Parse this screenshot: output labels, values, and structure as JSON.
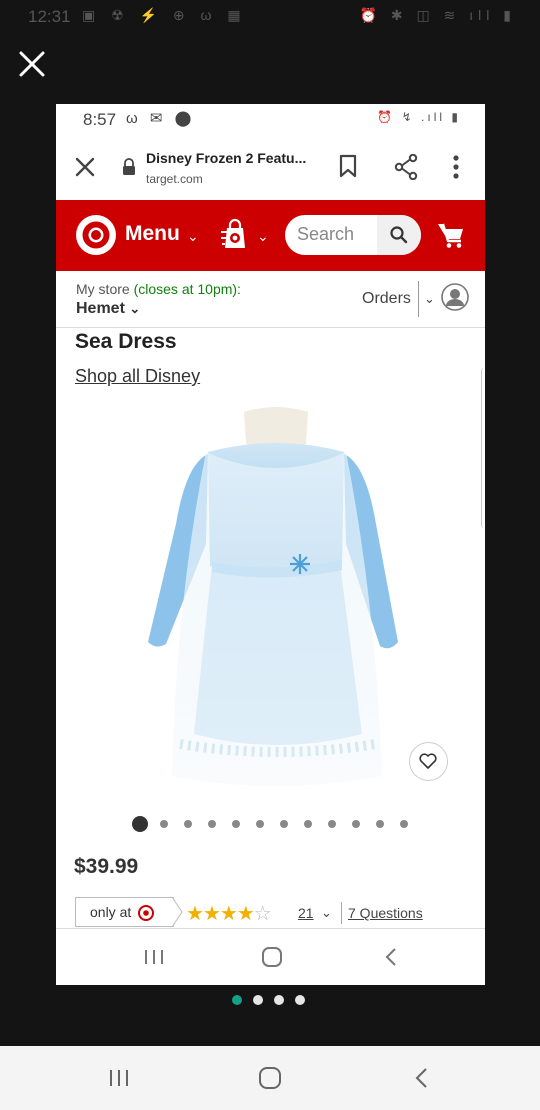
{
  "outer_status": {
    "time": "12:31",
    "left_icons": "▣ ☢ ⚡ ⊕ ω ▦",
    "right_icons": "⏰ ✱ ◫ ≋ ıll ▮"
  },
  "inner_status": {
    "time": "8:57",
    "left_icons": "ω ✉ ⬤",
    "right_icons": "⏰ ↯ .ıll ▮"
  },
  "browser": {
    "page_title": "Disney Frozen 2 Featu...",
    "domain": "target.com"
  },
  "header": {
    "menu_label": "Menu",
    "search_placeholder": "Search",
    "brand_color": "#cc0000"
  },
  "store": {
    "label": "My store",
    "hours": "(closes at 10pm):",
    "name": "Hemet",
    "orders_label": "Orders"
  },
  "product": {
    "title": "Sea Dress",
    "shop_link": "Shop all Disney",
    "price": "$39.99",
    "image_count": 12,
    "active_image": 1,
    "only_at_label": "only at",
    "rating": 4,
    "rating_max": 5,
    "review_count": "21",
    "questions_label": "7 Questions"
  },
  "viewer": {
    "pages": 4,
    "active_page": 1,
    "accent": "#16a085"
  }
}
